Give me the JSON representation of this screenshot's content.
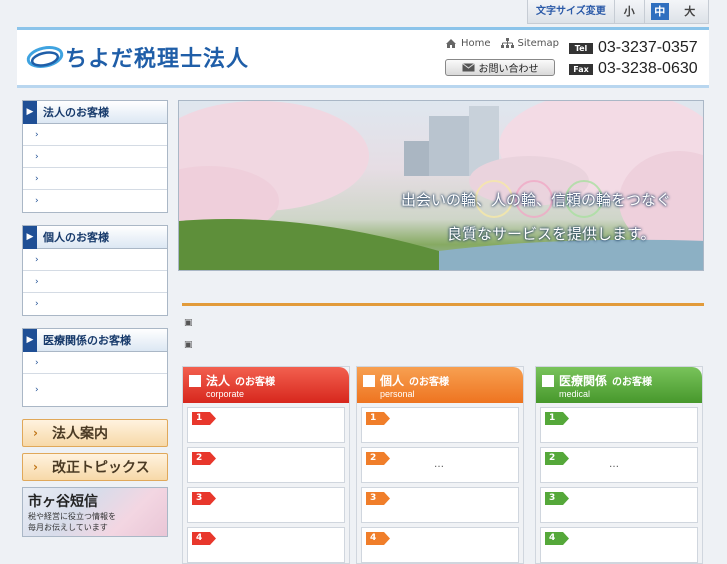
{
  "font_size": {
    "label": "文字サイズ変更",
    "options": [
      "小",
      "中",
      "大"
    ],
    "selected": "中"
  },
  "header": {
    "logo_text": "ちよだ税理士法人",
    "links": [
      {
        "label": "Home",
        "icon": "home-icon"
      },
      {
        "label": "Sitemap",
        "icon": "sitemap-icon"
      }
    ],
    "contact_label": "お問い合わせ",
    "tel": {
      "tag": "Tel",
      "number": "03-3237-0357"
    },
    "fax": {
      "tag": "Fax",
      "number": "03-3238-0630"
    }
  },
  "sidebar": {
    "sections": [
      {
        "title": "法人のお客様",
        "items": [
          "›",
          "›",
          "›",
          "›"
        ]
      },
      {
        "title": "個人のお客様",
        "items": [
          "›",
          "›",
          "›"
        ]
      },
      {
        "title": "医療関係のお客様",
        "items": [
          "›",
          "›"
        ]
      }
    ],
    "banners": [
      "法人案内",
      "改正トピックス"
    ],
    "photo_banner": {
      "title": "市ヶ谷短信",
      "sub1": "税や経営に役立つ情報を",
      "sub2": "毎月お伝えしています"
    }
  },
  "hero": {
    "line1": "出会いの輪、人の輪、信頼の輪をつなぐ",
    "line2": "良質なサービスを提供します。"
  },
  "news": {
    "bullets": [
      "▣",
      "▣"
    ]
  },
  "columns": [
    {
      "title": "法人",
      "title_small": "のお客様",
      "sub": "corporate",
      "color": "#e8372c",
      "rows": [
        "1",
        "2",
        "3",
        "4"
      ],
      "ellipsis": ""
    },
    {
      "title": "個人",
      "title_small": "のお客様",
      "sub": "personal",
      "color": "#f07e2a",
      "rows": [
        "1",
        "2",
        "3",
        "4"
      ],
      "ellipsis": "…"
    },
    {
      "title": "医療関係",
      "title_small": "のお客様",
      "sub": "medical",
      "color": "#55a83a",
      "rows": [
        "1",
        "2",
        "3",
        "4"
      ],
      "ellipsis": "…"
    }
  ]
}
